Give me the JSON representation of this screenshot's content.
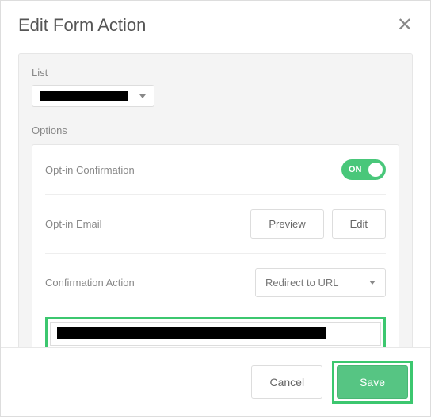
{
  "header": {
    "title": "Edit Form Action"
  },
  "list": {
    "label": "List",
    "selected": "[redacted]"
  },
  "options": {
    "label": "Options",
    "optin_confirmation": {
      "label": "Opt-in Confirmation",
      "toggle_text": "ON",
      "state": true
    },
    "optin_email": {
      "label": "Opt-in Email",
      "preview_label": "Preview",
      "edit_label": "Edit"
    },
    "confirmation_action": {
      "label": "Confirmation Action",
      "selected": "Redirect to URL"
    },
    "url_value": "[redacted]"
  },
  "footer": {
    "cancel_label": "Cancel",
    "save_label": "Save"
  }
}
